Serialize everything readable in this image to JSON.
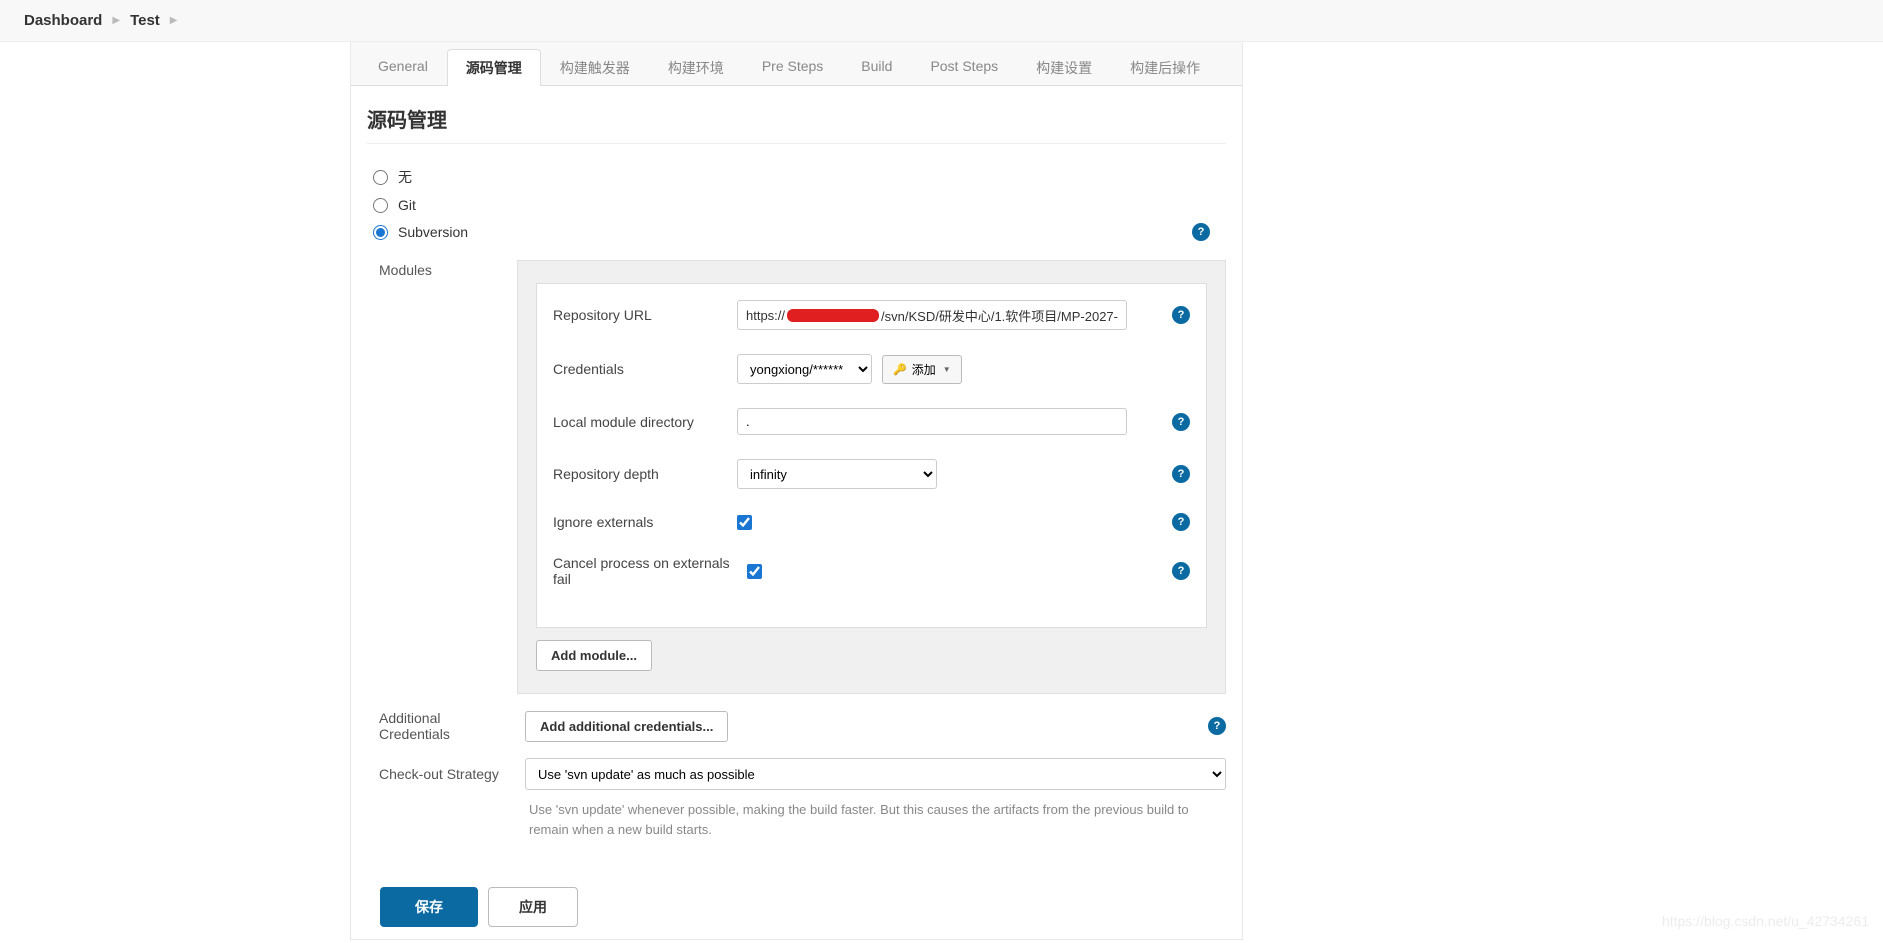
{
  "breadcrumb": [
    "Dashboard",
    "Test"
  ],
  "tabs": [
    {
      "label": "General",
      "active": false
    },
    {
      "label": "源码管理",
      "active": true
    },
    {
      "label": "构建触发器",
      "active": false
    },
    {
      "label": "构建环境",
      "active": false
    },
    {
      "label": "Pre Steps",
      "active": false
    },
    {
      "label": "Build",
      "active": false
    },
    {
      "label": "Post Steps",
      "active": false
    },
    {
      "label": "构建设置",
      "active": false
    },
    {
      "label": "构建后操作",
      "active": false
    }
  ],
  "section": {
    "title": "源码管理"
  },
  "scm_options": {
    "none": "无",
    "git": "Git",
    "subversion": "Subversion",
    "selected": "subversion"
  },
  "modules": {
    "label": "Modules",
    "repo_url_label": "Repository URL",
    "repo_url_prefix": "https://",
    "repo_url_suffix": "/svn/KSD/研发中心/1.软件项目/MP-2027-",
    "credentials_label": "Credentials",
    "credentials_value": "yongxiong/******",
    "add_cred_label": "添加",
    "local_dir_label": "Local module directory",
    "local_dir_value": ".",
    "depth_label": "Repository depth",
    "depth_value": "infinity",
    "ignore_ext_label": "Ignore externals",
    "ignore_ext_checked": true,
    "cancel_ext_label": "Cancel process on externals fail",
    "cancel_ext_checked": true,
    "add_module_label": "Add module..."
  },
  "additional_credentials": {
    "label": "Additional Credentials",
    "button": "Add additional credentials..."
  },
  "checkout": {
    "label": "Check-out Strategy",
    "value": "Use 'svn update' as much as possible",
    "description": "Use 'svn update' whenever possible, making the build faster. But this causes the artifacts from the previous build to remain when a new build starts."
  },
  "buttons": {
    "save": "保存",
    "apply": "应用"
  },
  "watermark": "https://blog.csdn.net/u_42734261"
}
